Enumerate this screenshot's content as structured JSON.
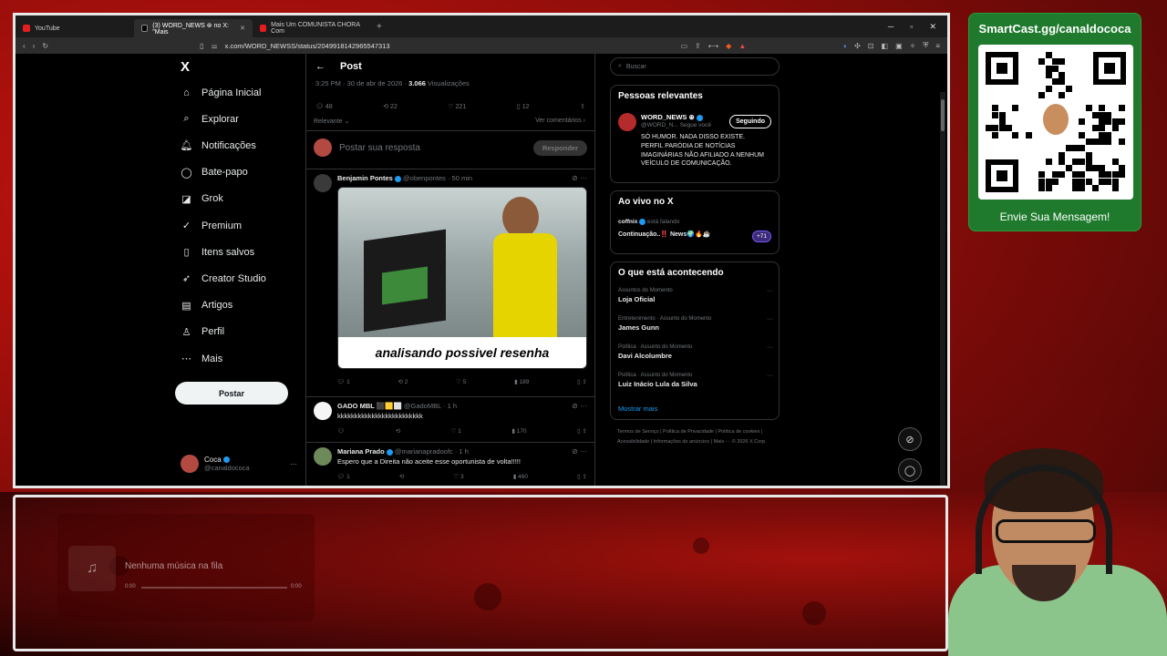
{
  "browser": {
    "tabs": [
      {
        "label": "YouTube",
        "type": "youtube",
        "active": false
      },
      {
        "label": "(3) WORD_NEWS ⊛ no X: \"Mais",
        "type": "x",
        "active": true
      },
      {
        "label": "Mais Um COMUNISTA CHORA Com",
        "type": "youtube",
        "active": false
      }
    ],
    "url": "x.com/WORD_NEWSS/status/2049918142965547313"
  },
  "sidebar": {
    "logo": "X",
    "items": [
      {
        "label": "Página Inicial",
        "icon": "home-icon",
        "glyph": "⌂"
      },
      {
        "label": "Explorar",
        "icon": "search-icon",
        "glyph": "⌕"
      },
      {
        "label": "Notificações",
        "icon": "bell-icon",
        "glyph": "🔔︎"
      },
      {
        "label": "Bate-papo",
        "icon": "chat-icon",
        "glyph": "◯"
      },
      {
        "label": "Grok",
        "icon": "grok-icon",
        "glyph": "◪"
      },
      {
        "label": "Premium",
        "icon": "premium-icon",
        "glyph": "✓"
      },
      {
        "label": "Itens salvos",
        "icon": "bookmark-icon",
        "glyph": "▯"
      },
      {
        "label": "Creator Studio",
        "icon": "rocket-icon",
        "glyph": "➶"
      },
      {
        "label": "Artigos",
        "icon": "article-icon",
        "glyph": "▤"
      },
      {
        "label": "Perfil",
        "icon": "person-icon",
        "glyph": "♙"
      },
      {
        "label": "Mais",
        "icon": "more-icon",
        "glyph": "⋯"
      }
    ],
    "post_button": "Postar",
    "profile": {
      "name": "Coca",
      "handle": "@canaldococa"
    }
  },
  "post": {
    "title": "Post",
    "timestamp": "3:25 PM · 30 de abr de 2026 · ",
    "views": "3.066",
    "views_label": " Visualizações",
    "replies": "48",
    "reposts": "22",
    "likes": "221",
    "bookmarks": "12",
    "sort": "Relevante",
    "view_quotes": "Ver comentários",
    "reply_placeholder": "Postar sua resposta",
    "reply_button": "Responder"
  },
  "replies": [
    {
      "name": "Benjamin Pontes",
      "handle": "@obenpontes · 50 min",
      "media_caption": "analisando possivel resenha",
      "replies": "1",
      "reposts": "2",
      "likes": "5",
      "views": "189"
    },
    {
      "name": "GADO MBL ⬛🟨⬜",
      "handle": "@GadoMBL · 1 h",
      "text": "kkkkkkkkkkkkkkkkkkkkkkkkk",
      "replies": "",
      "reposts": "",
      "likes": "1",
      "views": "170"
    },
    {
      "name": "Mariana Prado",
      "handle": "@marianapradoofc · 1 h",
      "text": "Espero que a Direita não aceite esse oportunista de volta!!!!!",
      "replies": "1",
      "reposts": "",
      "likes": "3",
      "views": "460"
    }
  ],
  "right": {
    "search_placeholder": "Buscar",
    "relevant": {
      "title": "Pessoas relevantes",
      "name": "WORD_NEWS ⊛",
      "handle": "@WORD_N... Segue você",
      "button": "Seguindo",
      "bio": "SÓ HUMOR. NADA DISSO EXISTE. PERFIL PARÓDIA DE NOTÍCIAS IMAGINÁRIAS NÃO AFILIADO A NENHUM VEÍCULO DE COMUNICAÇÃO."
    },
    "live": {
      "title": "Ao vivo no X",
      "host": "coffnix",
      "host_status": " está falando",
      "space_title": "Continuação..‼️ News🌍🔥☕",
      "count": "+71"
    },
    "trends": {
      "title": "O que está acontecendo",
      "items": [
        {
          "category": "Assuntos do Momento",
          "name": "Loja Oficial"
        },
        {
          "category": "Entretenimento · Assunto do Momento",
          "name": "James Gunn"
        },
        {
          "category": "Política · Assunto do Momento",
          "name": "Davi Alcolumbre"
        },
        {
          "category": "Política · Assunto do Momento",
          "name": "Luiz Inácio Lula da Silva"
        }
      ],
      "show_more": "Mostrar mais"
    },
    "footer": "Termos de Serviço  |  Política de Privacidade  |  Política de cookies  |  Acessibilidade  |  Informações de anúncios  |  Mais ···  © 2026 X Corp."
  },
  "overlay": {
    "qr_title": "SmartCast.gg/canaldococa",
    "qr_cta": "Envie Sua Mensagem!",
    "music_empty": "Nenhuma música na fila",
    "music_time_start": "0:00",
    "music_time_end": "0:00"
  }
}
